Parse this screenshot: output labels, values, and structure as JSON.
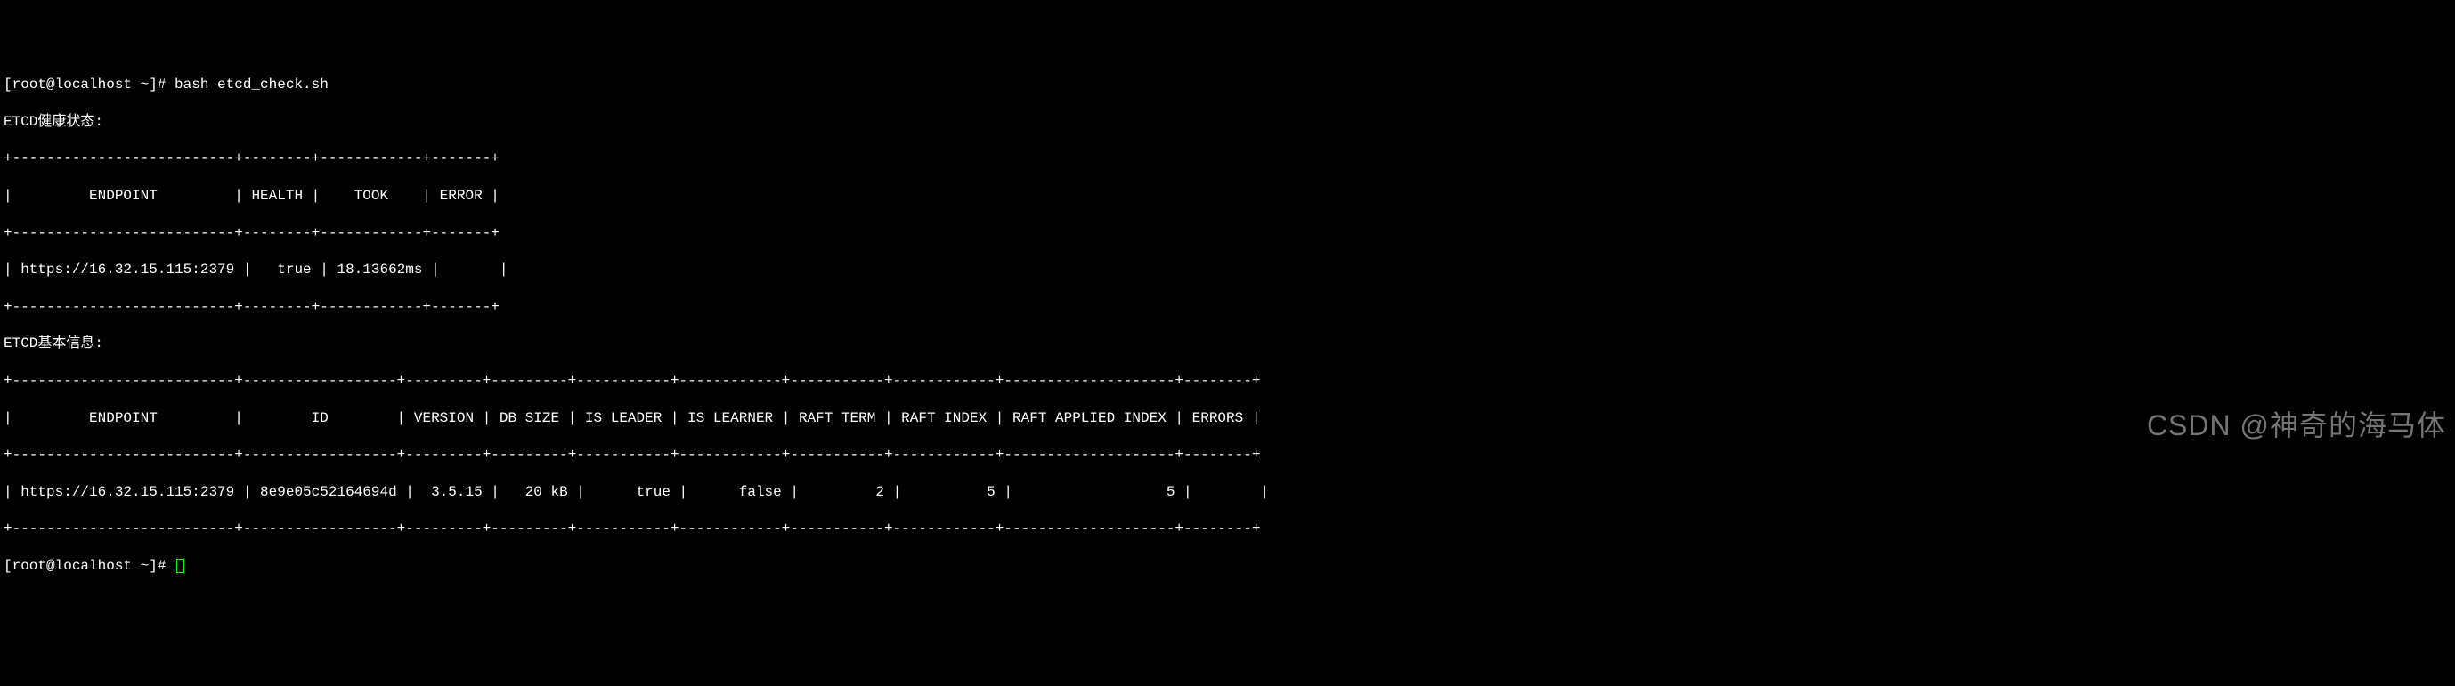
{
  "prompt1": "[root@localhost ~]# bash etcd_check.sh",
  "heading_health": "ETCD健康状态:",
  "health_table": {
    "border_top": "+--------------------------+--------+------------+-------+",
    "header": "|         ENDPOINT         | HEALTH |    TOOK    | ERROR |",
    "border_mid": "+--------------------------+--------+------------+-------+",
    "row": "| https://16.32.15.115:2379 |   true | 18.13662ms |       |",
    "border_bot": "+--------------------------+--------+------------+-------+",
    "columns": [
      "ENDPOINT",
      "HEALTH",
      "TOOK",
      "ERROR"
    ],
    "rows": [
      {
        "endpoint": "https://16.32.15.115:2379",
        "health": "true",
        "took": "18.13662ms",
        "error": ""
      }
    ]
  },
  "heading_info": "ETCD基本信息:",
  "info_table": {
    "border_top": "+--------------------------+------------------+---------+---------+-----------+------------+-----------+------------+--------------------+--------+",
    "header": "|         ENDPOINT         |        ID        | VERSION | DB SIZE | IS LEADER | IS LEARNER | RAFT TERM | RAFT INDEX | RAFT APPLIED INDEX | ERRORS |",
    "border_mid": "+--------------------------+------------------+---------+---------+-----------+------------+-----------+------------+--------------------+--------+",
    "row": "| https://16.32.15.115:2379 | 8e9e05c52164694d |  3.5.15 |   20 kB |      true |      false |         2 |          5 |                  5 |        |",
    "border_bot": "+--------------------------+------------------+---------+---------+-----------+------------+-----------+------------+--------------------+--------+",
    "columns": [
      "ENDPOINT",
      "ID",
      "VERSION",
      "DB SIZE",
      "IS LEADER",
      "IS LEARNER",
      "RAFT TERM",
      "RAFT INDEX",
      "RAFT APPLIED INDEX",
      "ERRORS"
    ],
    "rows": [
      {
        "endpoint": "https://16.32.15.115:2379",
        "id": "8e9e05c52164694d",
        "version": "3.5.15",
        "db_size": "20 kB",
        "is_leader": "true",
        "is_learner": "false",
        "raft_term": "2",
        "raft_index": "5",
        "raft_applied_index": "5",
        "errors": ""
      }
    ]
  },
  "prompt2": "[root@localhost ~]# ",
  "watermark": "CSDN @神奇的海马体"
}
